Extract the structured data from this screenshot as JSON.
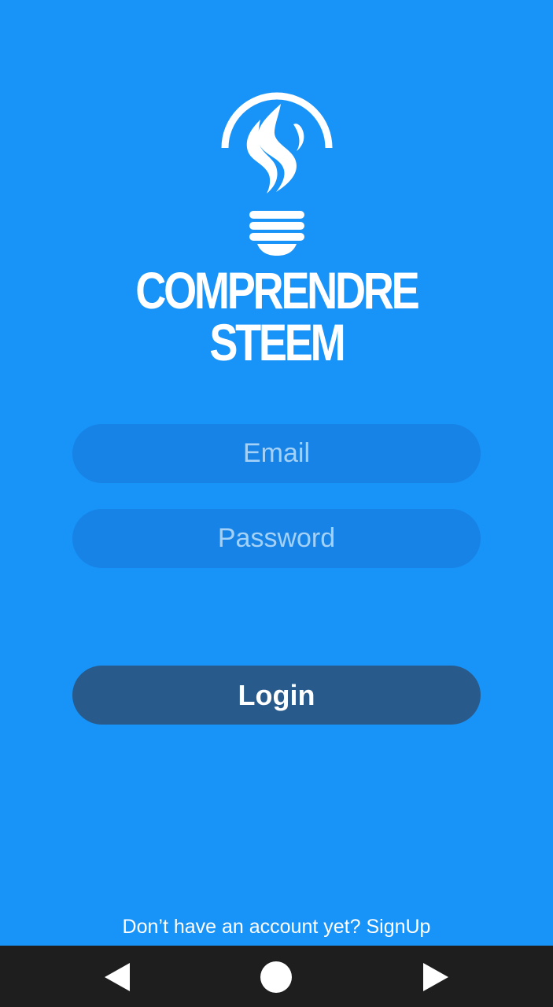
{
  "app": {
    "brand_line1": "COMPRENDRE",
    "brand_line2": "STEEM"
  },
  "form": {
    "email_placeholder": "Email",
    "password_placeholder": "Password",
    "login_label": "Login"
  },
  "footer": {
    "prompt": "Don’t have an account yet?",
    "signup_link": "SignUp"
  },
  "navbar": {
    "back_icon": "back-triangle-icon",
    "home_icon": "home-circle-icon",
    "recent_icon": "forward-triangle-icon"
  },
  "colors": {
    "background": "#1893f8",
    "field": "#1783e6",
    "login_button": "#285b8c",
    "navbar": "#1e1e1e"
  }
}
